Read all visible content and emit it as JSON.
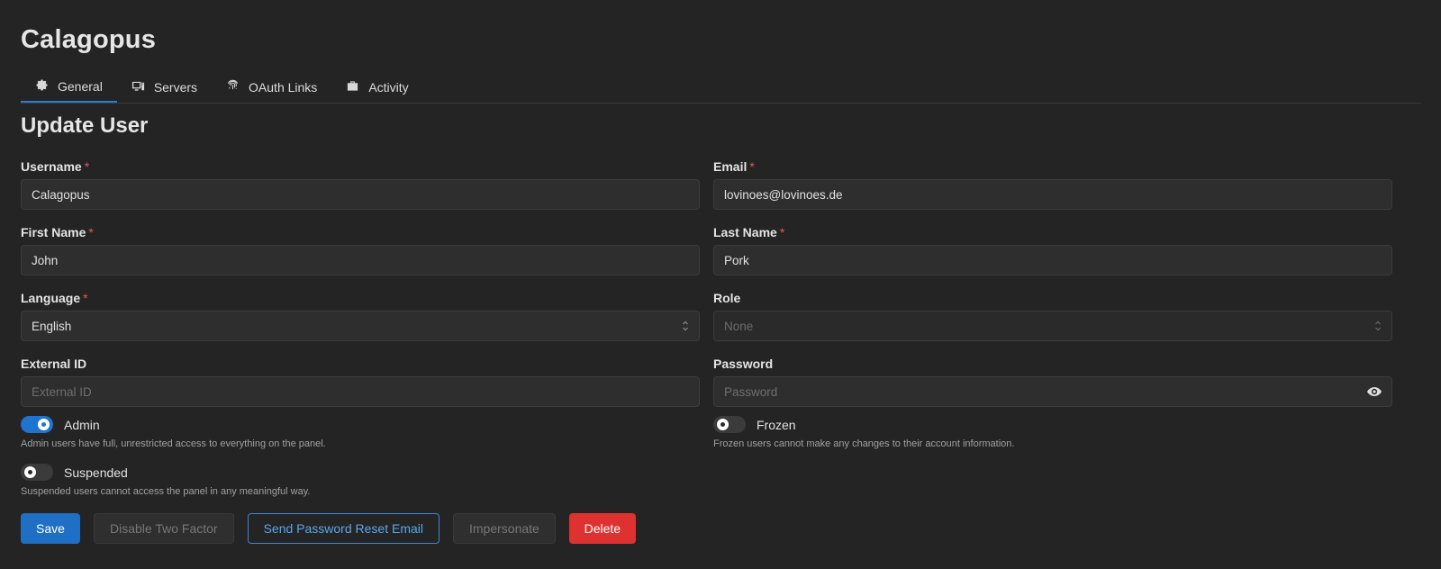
{
  "app": {
    "title": "Calagopus"
  },
  "tabs": [
    {
      "label": "General",
      "icon": "gear-icon",
      "active": true
    },
    {
      "label": "Servers",
      "icon": "servers-icon",
      "active": false
    },
    {
      "label": "OAuth Links",
      "icon": "fingerprint-icon",
      "active": false
    },
    {
      "label": "Activity",
      "icon": "briefcase-icon",
      "active": false
    }
  ],
  "form": {
    "title": "Update User",
    "required_marker": "*",
    "username": {
      "label": "Username",
      "value": "Calagopus"
    },
    "email": {
      "label": "Email",
      "value": "lovinoes@lovinoes.de"
    },
    "first_name": {
      "label": "First Name",
      "value": "John"
    },
    "last_name": {
      "label": "Last Name",
      "value": "Pork"
    },
    "language": {
      "label": "Language",
      "value": "English"
    },
    "role": {
      "label": "Role",
      "value": "None"
    },
    "external_id": {
      "label": "External ID",
      "placeholder": "External ID"
    },
    "password": {
      "label": "Password",
      "placeholder": "Password"
    },
    "admin": {
      "label": "Admin",
      "on": true,
      "description": "Admin users have full, unrestricted access to everything on the panel."
    },
    "frozen": {
      "label": "Frozen",
      "on": false,
      "description": "Frozen users cannot make any changes to their account information."
    },
    "suspended": {
      "label": "Suspended",
      "on": false,
      "description": "Suspended users cannot access the panel in any meaningful way."
    }
  },
  "actions": {
    "save": "Save",
    "disable_two_factor": "Disable Two Factor",
    "send_password_reset": "Send Password Reset Email",
    "impersonate": "Impersonate",
    "delete": "Delete"
  },
  "colors": {
    "background": "#242424",
    "accent": "#1f74d0",
    "danger": "#e03131",
    "required": "#e35656"
  }
}
